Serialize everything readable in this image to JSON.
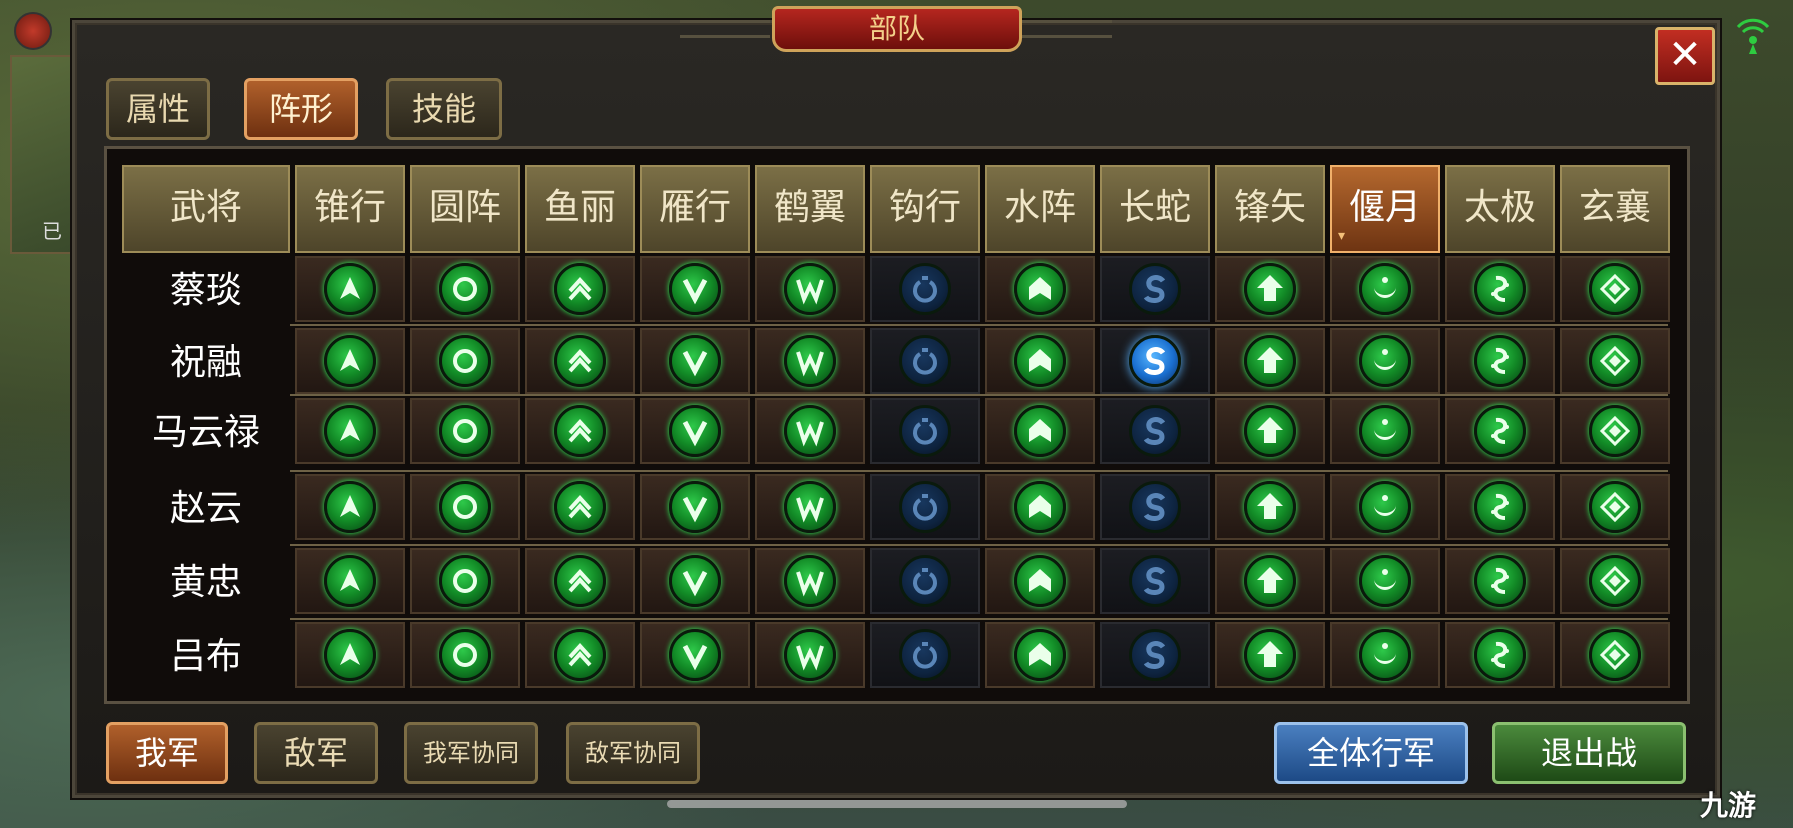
{
  "window": {
    "title": "部队",
    "close_glyph": "✕"
  },
  "map": {
    "minimap_text": "已"
  },
  "tabs": [
    {
      "label": "属性",
      "active": false
    },
    {
      "label": "阵形",
      "active": true
    },
    {
      "label": "技能",
      "active": false
    }
  ],
  "table": {
    "header_first": "武将",
    "formations": [
      "锥行",
      "圆阵",
      "鱼丽",
      "雁行",
      "鹤翼",
      "钩行",
      "水阵",
      "长蛇",
      "锋矢",
      "偃月",
      "太极",
      "玄襄"
    ],
    "selected_formation": "偃月",
    "generals": [
      "蔡琰",
      "祝融",
      "马云禄",
      "赵云",
      "黄忠",
      "吕布"
    ],
    "formation_icons": [
      "arrow-up-icon",
      "ring-icon",
      "double-chevron-icon",
      "v-icon",
      "w-icon",
      "hook-icon",
      "house-icon",
      "s-snake-icon",
      "bold-arrow-icon",
      "crescent-icon",
      "taiji-icon",
      "diamond-icon"
    ],
    "locked_formations": [
      "钩行",
      "长蛇"
    ],
    "highlighted_cell": {
      "general": "祝融",
      "formation": "长蛇"
    }
  },
  "bottom_buttons": {
    "my_army": "我军",
    "enemy_army": "敌军",
    "my_coop": "我军协同",
    "enemy_coop": "敌军协同",
    "march_all": "全体行军",
    "exit_battle": "退出战"
  },
  "watermark": "九游",
  "colors": {
    "accent_orange": "#b0602b",
    "title_red": "#b5261f",
    "icon_green": "#2ec94a",
    "icon_blue": "#1a6fd0"
  }
}
